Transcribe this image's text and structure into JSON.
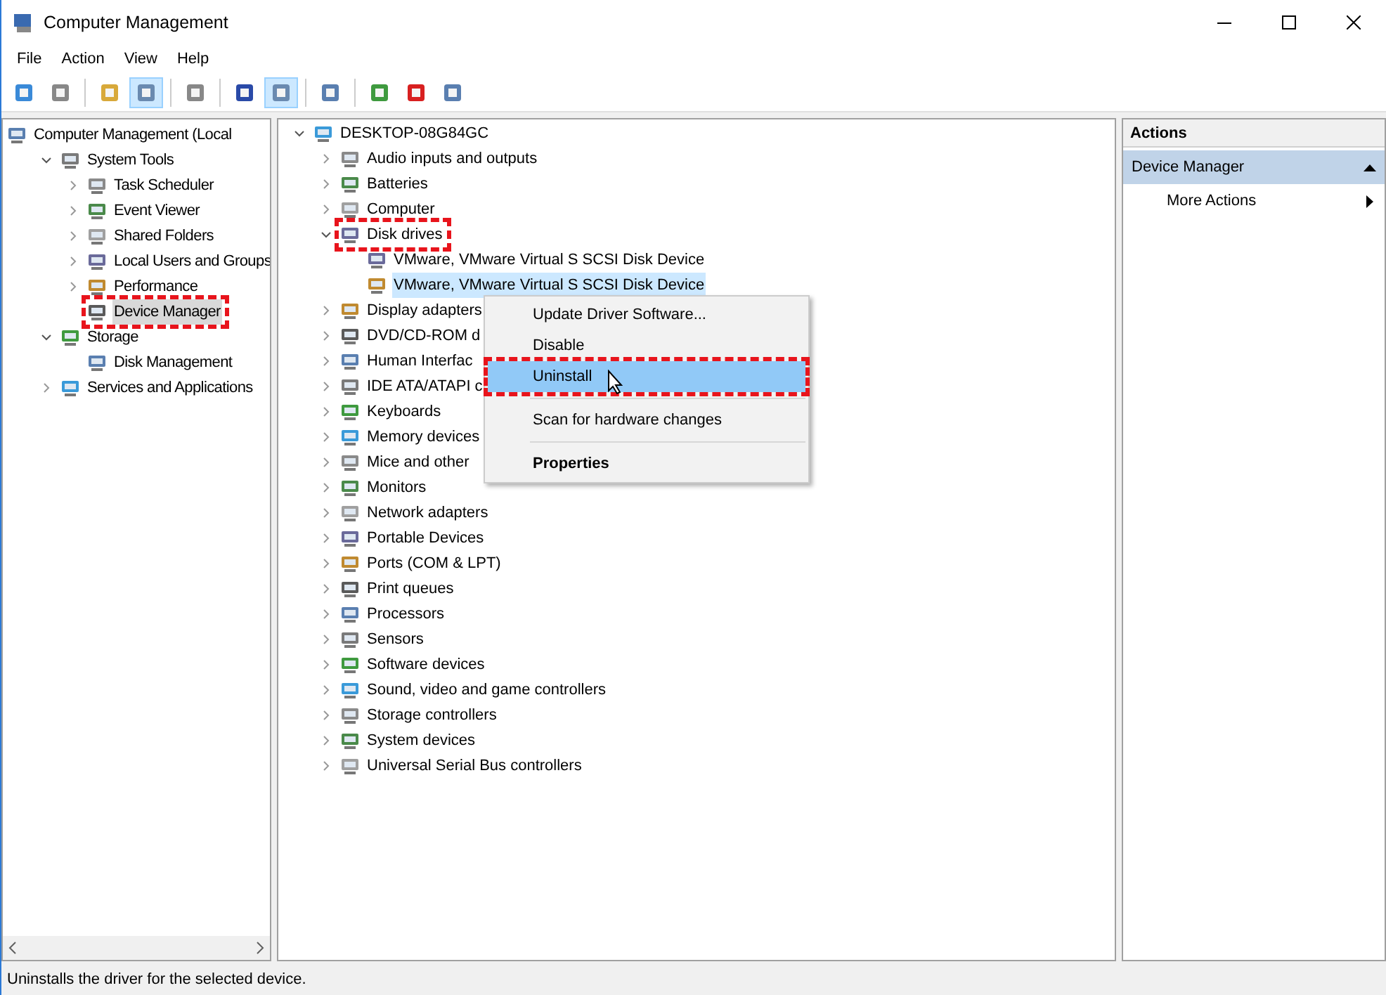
{
  "window": {
    "title": "Computer Management"
  },
  "menu": [
    "File",
    "Action",
    "View",
    "Help"
  ],
  "toolbar": [
    {
      "pressed": false
    },
    {
      "pressed": false
    },
    {
      "pressed": false
    },
    {
      "pressed": true
    },
    {
      "pressed": false
    },
    {
      "pressed": false
    },
    {
      "pressed": true
    },
    {
      "pressed": false
    },
    {
      "pressed": false
    },
    {
      "pressed": false
    },
    {
      "pressed": false
    }
  ],
  "left_tree": [
    {
      "label": "Computer Management (Local",
      "selected": false,
      "annotated": false,
      "children": [
        {
          "label": "System Tools",
          "expanded": true,
          "selected": false,
          "annotated": false,
          "children": [
            {
              "label": "Task Scheduler",
              "expanded": false,
              "selected": false,
              "annotated": false
            },
            {
              "label": "Event Viewer",
              "expanded": false,
              "selected": false,
              "annotated": false
            },
            {
              "label": "Shared Folders",
              "expanded": false,
              "selected": false,
              "annotated": false
            },
            {
              "label": "Local Users and Groups",
              "expanded": false,
              "selected": false,
              "annotated": false
            },
            {
              "label": "Performance",
              "expanded": false,
              "selected": false,
              "annotated": false
            },
            {
              "label": "Device Manager",
              "selected": true,
              "annotated": true
            }
          ]
        },
        {
          "label": "Storage",
          "expanded": true,
          "selected": false,
          "annotated": false,
          "children": [
            {
              "label": "Disk Management",
              "selected": false,
              "annotated": false
            }
          ]
        },
        {
          "label": "Services and Applications",
          "expanded": false,
          "selected": false,
          "annotated": false
        }
      ]
    }
  ],
  "device_tree": [
    {
      "label": "DESKTOP-08G84GC",
      "expanded": true,
      "selected": false,
      "annotated": false,
      "children": [
        {
          "label": "Audio inputs and outputs",
          "expanded": false,
          "selected": false,
          "annotated": false
        },
        {
          "label": "Batteries",
          "expanded": false,
          "selected": false,
          "annotated": false
        },
        {
          "label": "Computer",
          "expanded": false,
          "selected": false,
          "annotated": false
        },
        {
          "label": "Disk drives",
          "expanded": true,
          "selected": false,
          "annotated": true,
          "children": [
            {
              "label": "VMware, VMware Virtual S SCSI Disk Device",
              "selected": false,
              "annotated": false
            },
            {
              "label": "VMware, VMware Virtual S SCSI Disk Device",
              "selected": true,
              "annotated": false
            }
          ]
        },
        {
          "label": "Display adapters",
          "expanded": false,
          "selected": false,
          "annotated": false
        },
        {
          "label": "DVD/CD-ROM d",
          "expanded": false,
          "selected": false,
          "annotated": false
        },
        {
          "label": "Human Interfac",
          "expanded": false,
          "selected": false,
          "annotated": false
        },
        {
          "label": "IDE ATA/ATAPI c",
          "expanded": false,
          "selected": false,
          "annotated": false
        },
        {
          "label": "Keyboards",
          "expanded": false,
          "selected": false,
          "annotated": false
        },
        {
          "label": "Memory devices",
          "expanded": false,
          "selected": false,
          "annotated": false
        },
        {
          "label": "Mice and other",
          "expanded": false,
          "selected": false,
          "annotated": false
        },
        {
          "label": "Monitors",
          "expanded": false,
          "selected": false,
          "annotated": false
        },
        {
          "label": "Network adapters",
          "expanded": false,
          "selected": false,
          "annotated": false
        },
        {
          "label": "Portable Devices",
          "expanded": false,
          "selected": false,
          "annotated": false
        },
        {
          "label": "Ports (COM & LPT)",
          "expanded": false,
          "selected": false,
          "annotated": false
        },
        {
          "label": "Print queues",
          "expanded": false,
          "selected": false,
          "annotated": false
        },
        {
          "label": "Processors",
          "expanded": false,
          "selected": false,
          "annotated": false
        },
        {
          "label": "Sensors",
          "expanded": false,
          "selected": false,
          "annotated": false
        },
        {
          "label": "Software devices",
          "expanded": false,
          "selected": false,
          "annotated": false
        },
        {
          "label": "Sound, video and game controllers",
          "expanded": false,
          "selected": false,
          "annotated": false
        },
        {
          "label": "Storage controllers",
          "expanded": false,
          "selected": false,
          "annotated": false
        },
        {
          "label": "System devices",
          "expanded": false,
          "selected": false,
          "annotated": false
        },
        {
          "label": "Universal Serial Bus controllers",
          "expanded": false,
          "selected": false,
          "annotated": false
        }
      ]
    }
  ],
  "context_menu": [
    {
      "kind": "item",
      "label": "Update Driver Software...",
      "selected": false,
      "annotated": false,
      "default": false
    },
    {
      "kind": "item",
      "label": "Disable",
      "selected": false,
      "annotated": false,
      "default": false
    },
    {
      "kind": "item",
      "label": "Uninstall",
      "selected": true,
      "annotated": true,
      "default": false
    },
    {
      "kind": "separator"
    },
    {
      "kind": "item",
      "label": "Scan for hardware changes",
      "selected": false,
      "annotated": false,
      "default": false
    },
    {
      "kind": "separator"
    },
    {
      "kind": "item",
      "label": "Properties",
      "selected": false,
      "annotated": false,
      "default": true
    }
  ],
  "actions": {
    "title": "Actions",
    "section": {
      "label": "Device Manager",
      "expanded": true
    },
    "items": [
      {
        "label": "More Actions"
      }
    ]
  },
  "status_bar": "Uninstalls the driver for the selected device."
}
